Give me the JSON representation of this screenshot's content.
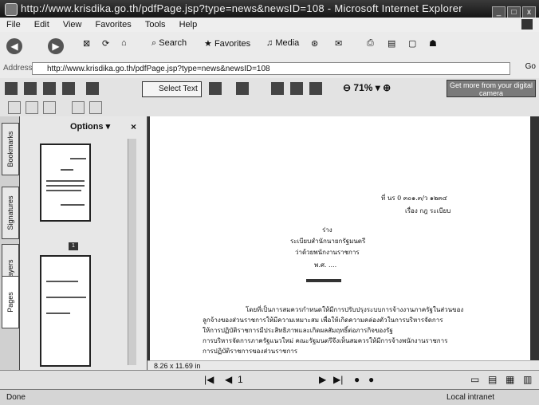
{
  "window": {
    "title": "http://www.krisdika.go.th/pdfPage.jsp?type=news&newsID=108 - Microsoft Internet Explorer"
  },
  "menu": [
    "File",
    "Edit",
    "View",
    "Favorites",
    "Tools",
    "Help"
  ],
  "toolbar": {
    "search": "Search",
    "favorites": "Favorites",
    "media": "Media"
  },
  "address": {
    "label": "Address",
    "url": "http://www.krisdika.go.th/pdfPage.jsp?type=news&newsID=108",
    "go": "Go"
  },
  "pdf_toolbar": {
    "select_text": "Select Text",
    "zoom": "71%",
    "camera_promo": "Get more from your digital camera"
  },
  "nav_pane": {
    "options": "Options",
    "tabs": [
      "Bookmarks",
      "Signatures",
      "Layers",
      "Pages"
    ],
    "page_label": "1"
  },
  "document": {
    "size": "8.26 x 11.69 in",
    "lines": [
      "ที่ นร 0 ๓๐๑.๓/ว ๑๒๓๔",
      "เรื่อง กฎ ระเบียบ",
      "ร่าง",
      "ระเบียบสำนักนายกรัฐมนตรี",
      "ว่าด้วยพนักงานราชการ",
      "พ.ศ. ....",
      "โดยที่เป็นการสมควรกำหนดให้มีการปรับปรุงระบบการจ้างงานภาครัฐในส่วนของ",
      "ลูกจ้างของส่วนราชการให้มีความเหมาะสม เพื่อให้เกิดความคล่องตัวในการบริหารจัดการ",
      "ให้การปฏิบัติราชการมีประสิทธิภาพและเกิดผลสัมฤทธิ์ต่อภารกิจของรัฐ",
      "การบริหารจัดการภาครัฐแนวใหม่ คณะรัฐมนตรีจึงเห็นสมควรให้มีการจ้างพนักงานราชการ",
      "การปฏิบัติราชการของส่วนราชการ"
    ]
  },
  "page_nav": {
    "current": "1"
  },
  "status": {
    "left": "Done",
    "zone": "Local intranet"
  }
}
